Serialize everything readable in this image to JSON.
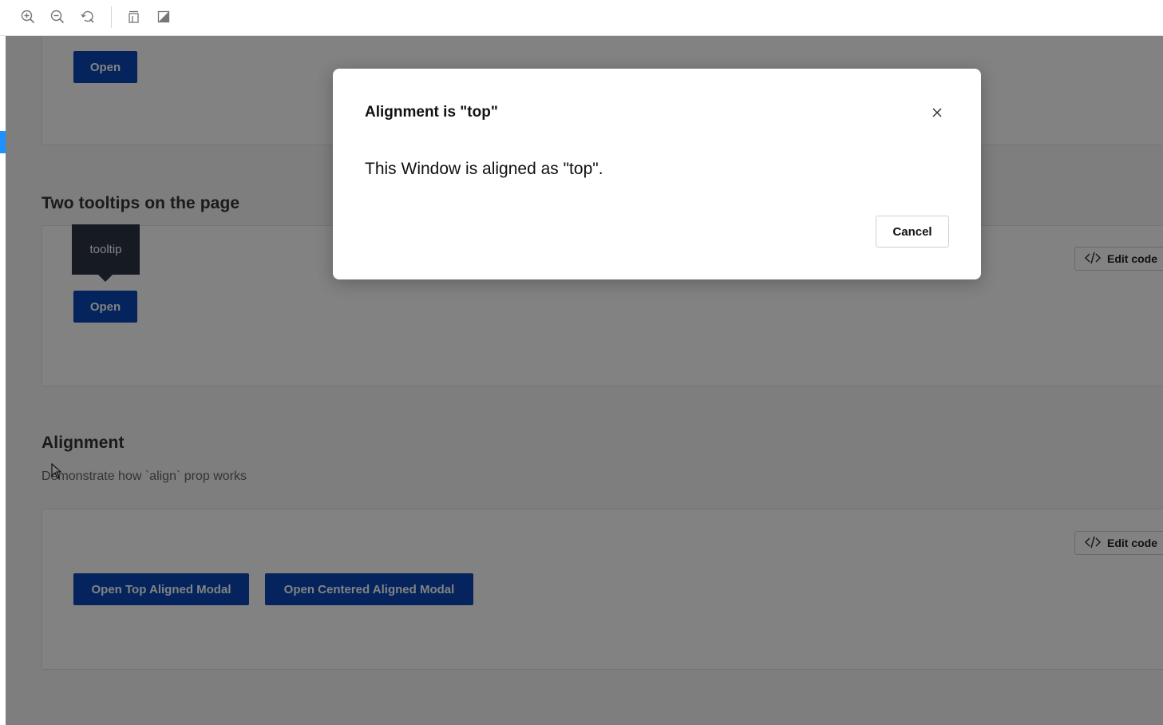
{
  "toolbar": {
    "icons": [
      "zoom-in-icon",
      "zoom-out-icon",
      "reset-zoom-icon",
      "layout-icon",
      "contrast-icon"
    ]
  },
  "sections": {
    "first": {
      "open_label": "Open"
    },
    "tooltips": {
      "title": "Two tooltips on the page",
      "tooltip_text": "tooltip",
      "open_label": "Open",
      "edit_code_label": "Edit code"
    },
    "alignment": {
      "title": "Alignment",
      "description": "Demonstrate how `align` prop works",
      "edit_code_label": "Edit code",
      "top_button_label": "Open Top Aligned Modal",
      "center_button_label": "Open Centered Aligned Modal"
    }
  },
  "modal": {
    "title": "Alignment is \"top\"",
    "body": "This Window is aligned as \"top\".",
    "cancel_label": "Cancel"
  },
  "colors": {
    "primary": "#0b48b9",
    "tooltip_bg": "#2b3445",
    "overlay": "rgba(0,0,0,0.49)",
    "accent_marker": "#1e90ff"
  }
}
